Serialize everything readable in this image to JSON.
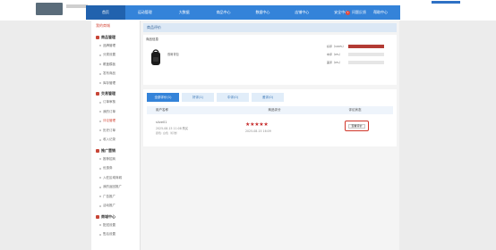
{
  "nav": {
    "items": [
      "首页",
      "运动管理",
      "大数据",
      "商品中心",
      "数据中心",
      "店铺中心",
      "安全中心",
      "帮助中心"
    ],
    "active_index": 0,
    "help_label": "问题反馈"
  },
  "sidebar": {
    "top": "我的商城",
    "sections": [
      {
        "title": "商品管理",
        "items": [
          "品牌管理",
          "分类设置",
          "覆盖模板",
          "发布商品",
          "库存管理"
        ]
      },
      {
        "title": "交易管理",
        "items": [
          "订单审核",
          "我的订单",
          "评论管理",
          "历史订单",
          "收入记录"
        ]
      },
      {
        "title": "推广营销",
        "items": [
          "推荐招商",
          "优惠券",
          "入驻区域商城",
          "我的返回推广",
          "广告推广",
          "活动推广"
        ]
      },
      {
        "title": "商城中心",
        "items": [
          "配送设置",
          "售后设置"
        ]
      }
    ],
    "active_item": "评论管理"
  },
  "main": {
    "title": "商品评价",
    "product": {
      "section_title": "商品信息",
      "name": "双肩背包",
      "ratings": [
        {
          "label": "好评（100%）",
          "percent": 100
        },
        {
          "label": "中评（0%）",
          "percent": 0
        },
        {
          "label": "差评（0%）",
          "percent": 0
        }
      ]
    },
    "tabs": [
      "全部评价(1)",
      "好评(1)",
      "中评(0)",
      "差评(0)"
    ],
    "active_tab": 0,
    "table": {
      "headers": [
        "用户名称",
        "商品评分",
        "评论状态"
      ],
      "rows": [
        {
          "buyer": "slive01",
          "time": "2025-08-15 11:08 购买",
          "sub": "颜色: 白色（标准）",
          "rating": 5,
          "rating_time": "2025-08-15 16:09",
          "action": "查看评价"
        }
      ]
    }
  },
  "colors": {
    "nav_blue": "#3483d9",
    "nav_active": "#2162ae",
    "accent_red": "#c62d2d"
  }
}
